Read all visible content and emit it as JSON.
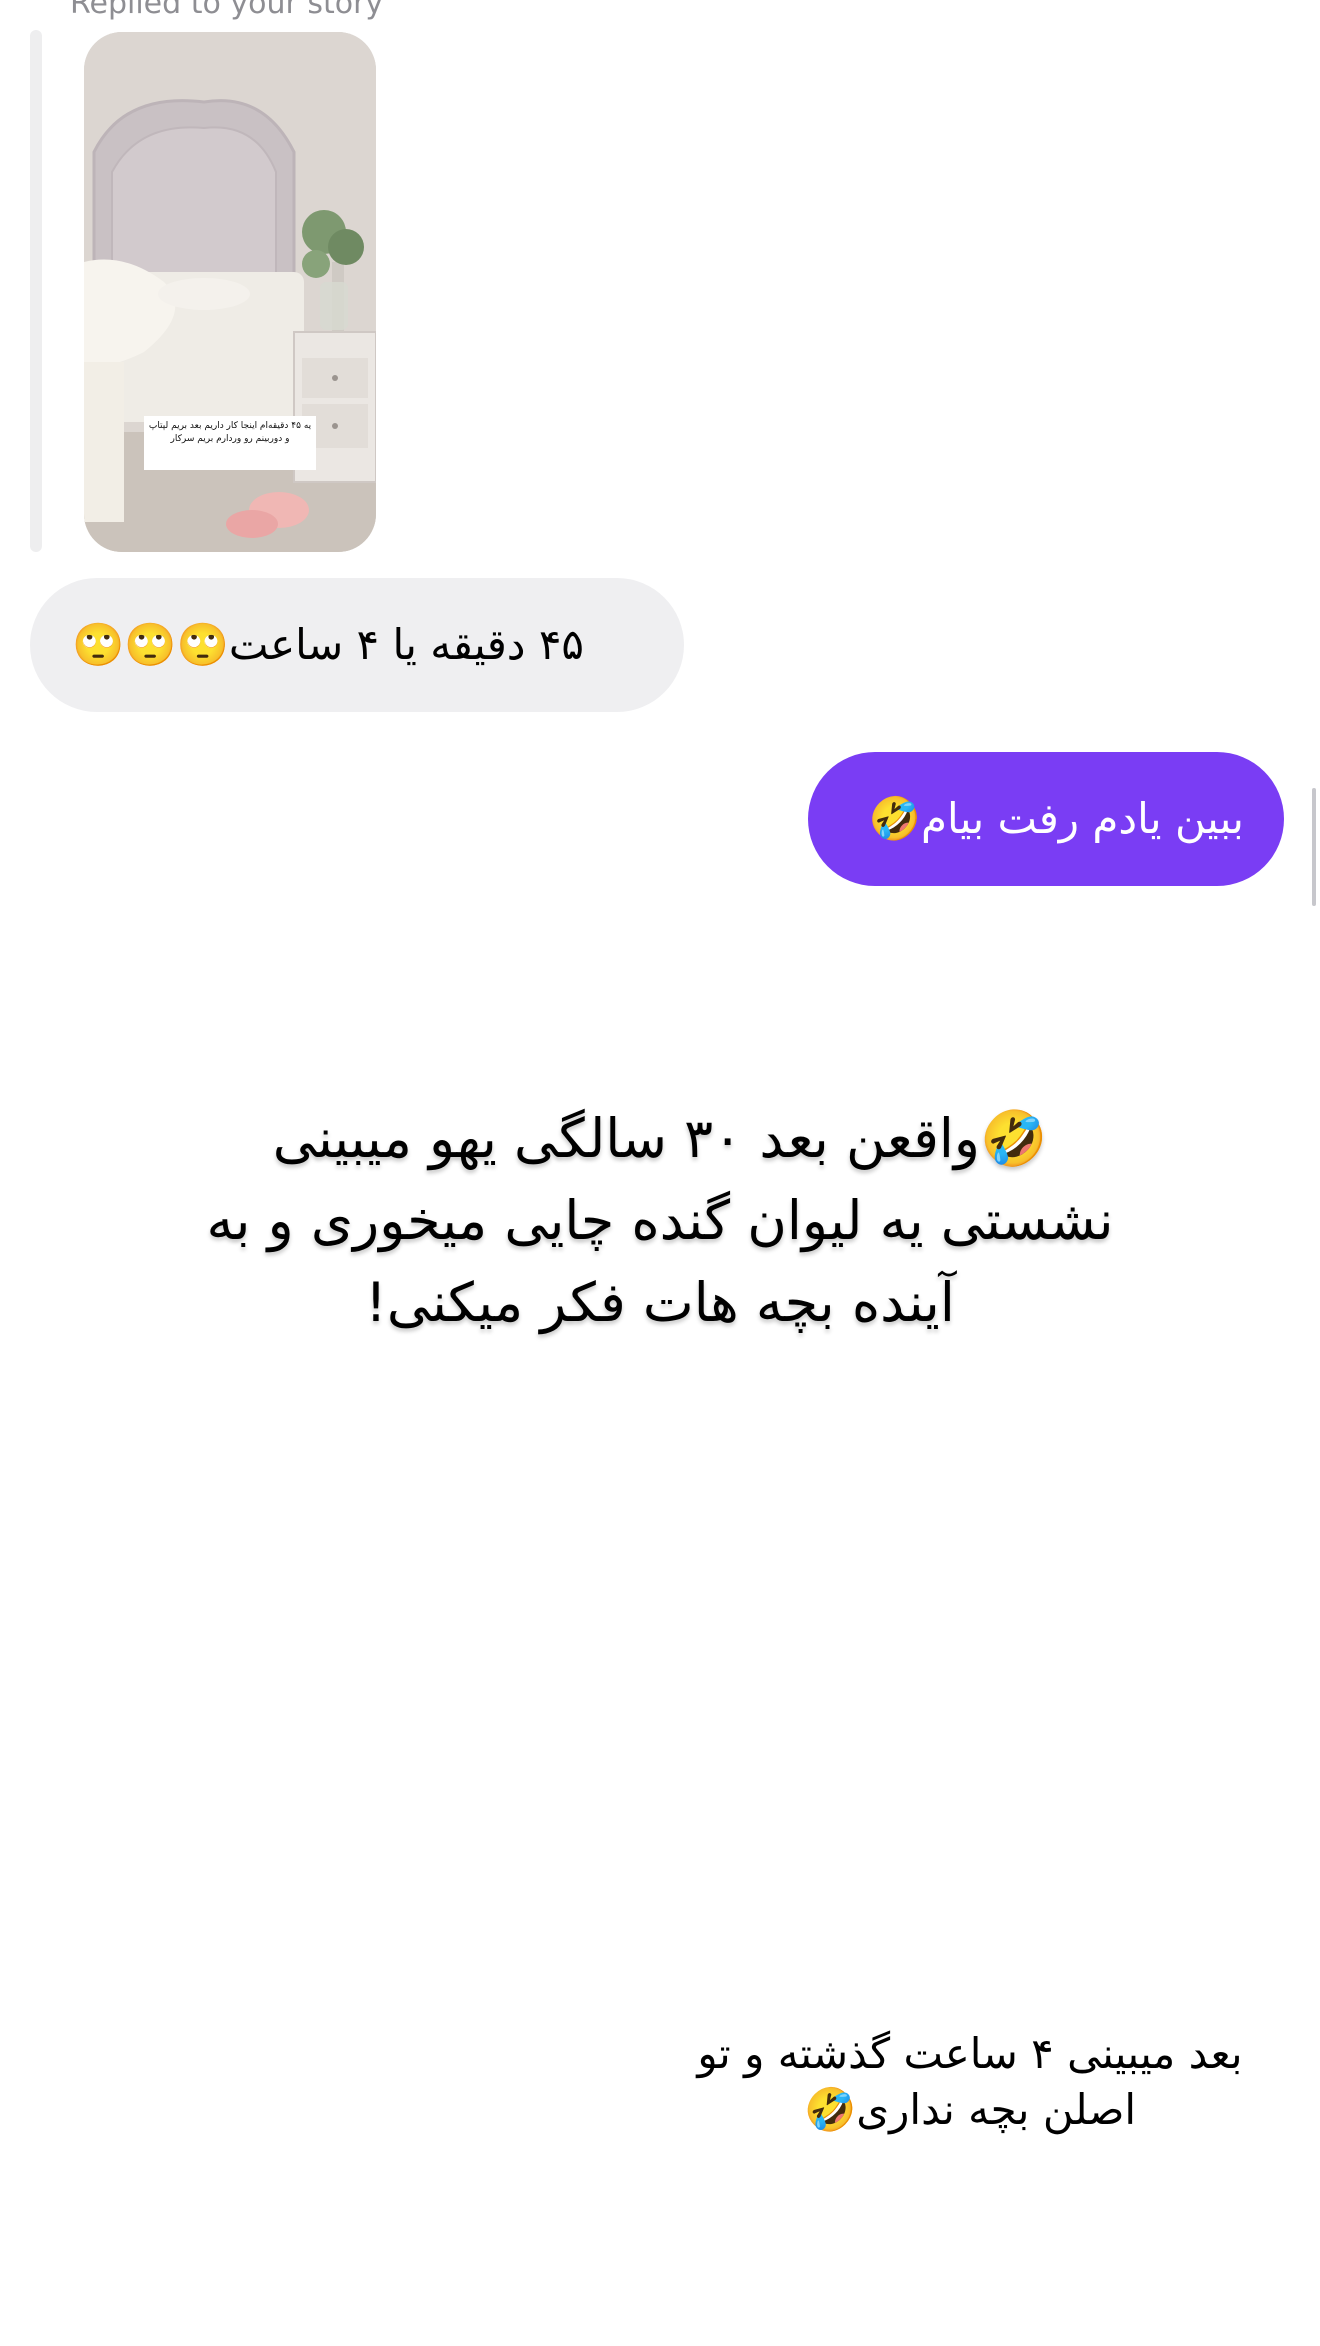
{
  "reply_context": {
    "label": "Replied to your story",
    "story_caption": "یه ۴۵ دقیقه‌ام اینجا کار داریم بعد بریم لپتاپ و دوربینم رو وردارم بریم سرکار"
  },
  "messages": [
    {
      "direction": "incoming",
      "text": "۴۵ دقیقه یا ۴ ساعت🙄🙄🙄"
    },
    {
      "direction": "outgoing",
      "text": "ببین یادم رفت بیام🤣"
    }
  ],
  "story_post": {
    "main_text": "🤣واقعن بعد ۳۰ سالگی یهو میبینی نشستی یه لیوان گنده چایی میخوری و به آینده بچه هات فکر میکنی!",
    "sub_text": "بعد میبینی ۴ ساعت گذشته و تو اصلن بچه نداری🤣"
  },
  "colors": {
    "incoming_bubble": "#efeff1",
    "outgoing_bubble": "#7a3df4",
    "outgoing_text": "#ffffff",
    "muted_text": "#8e8e93"
  }
}
